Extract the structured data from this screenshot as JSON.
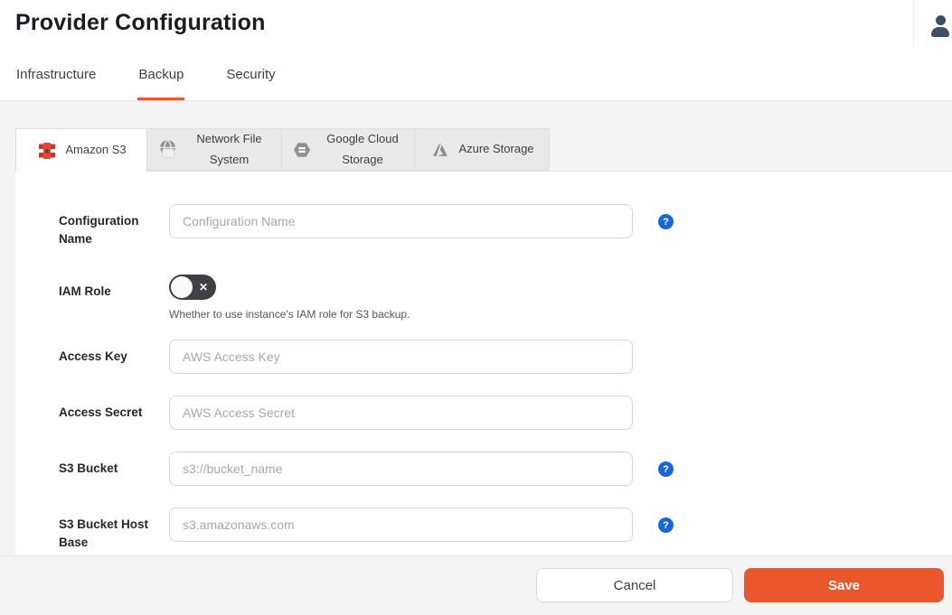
{
  "header": {
    "title": "Provider Configuration",
    "nav_tabs": [
      {
        "label": "Infrastructure",
        "active": false
      },
      {
        "label": "Backup",
        "active": true
      },
      {
        "label": "Security",
        "active": false
      }
    ]
  },
  "provider_tabs": [
    {
      "label": "Amazon S3",
      "icon": "amazon-s3-icon",
      "active": true
    },
    {
      "label": "Network File System",
      "icon": "globe-folder-icon",
      "active": false
    },
    {
      "label": "Google Cloud Storage",
      "icon": "gcs-hexagon-icon",
      "active": false
    },
    {
      "label": "Azure Storage",
      "icon": "azure-icon",
      "active": false
    }
  ],
  "form": {
    "fields": [
      {
        "label": "Configuration Name",
        "type": "text",
        "placeholder": "Configuration Name",
        "has_help": true
      },
      {
        "label": "IAM Role",
        "type": "toggle",
        "state": "off",
        "helper_text": "Whether to use instance's IAM role for S3 backup."
      },
      {
        "label": "Access Key",
        "type": "text",
        "placeholder": "AWS Access Key",
        "has_help": false
      },
      {
        "label": "Access Secret",
        "type": "text",
        "placeholder": "AWS Access Secret",
        "has_help": false
      },
      {
        "label": "S3 Bucket",
        "type": "text",
        "placeholder": "s3://bucket_name",
        "has_help": true
      },
      {
        "label": "S3 Bucket Host Base",
        "type": "text",
        "placeholder": "s3.amazonaws.com",
        "has_help": true
      }
    ]
  },
  "footer": {
    "cancel_label": "Cancel",
    "save_label": "Save"
  },
  "icons": {
    "help_glyph": "?",
    "toggle_off_glyph": "✕"
  },
  "colors": {
    "accent_orange": "#e8582c",
    "help_blue": "#1668d8",
    "toggle_dark": "#3f3f46",
    "user_icon_blue": "#3e4d6e",
    "page_bg": "#f4f4f5"
  }
}
